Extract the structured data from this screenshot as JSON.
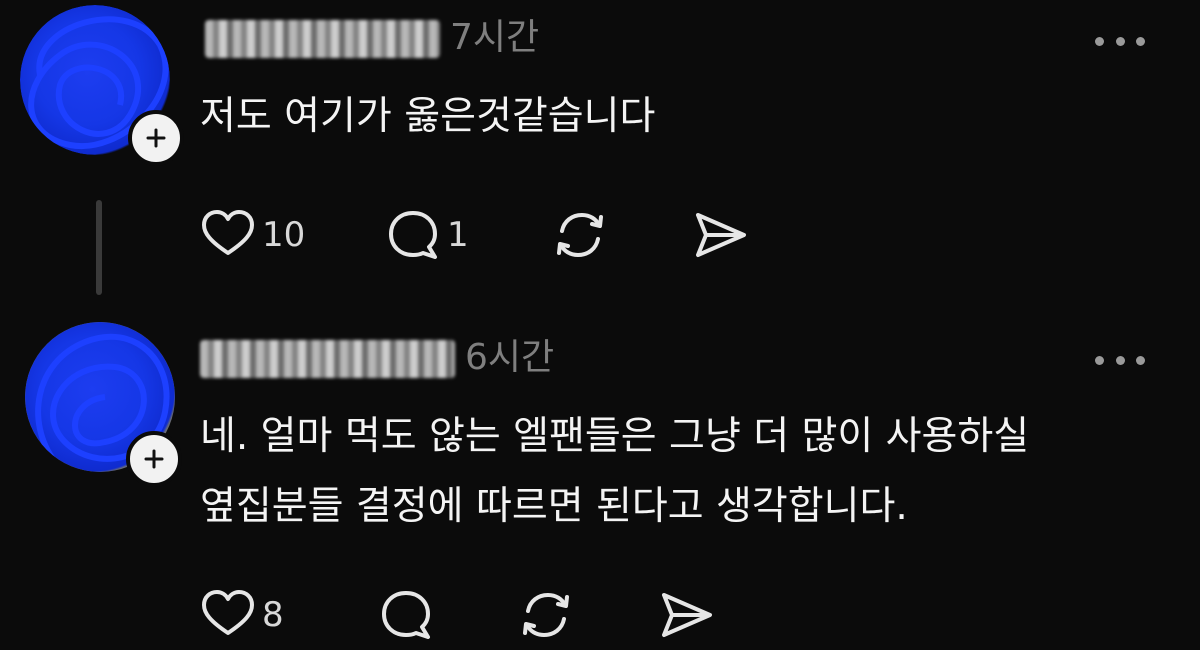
{
  "posts": [
    {
      "time": "7시간",
      "text_lines": [
        "저도 여기가 옳은것같습니다"
      ],
      "like_count": "10",
      "reply_count": "1"
    },
    {
      "time": "6시간",
      "text_lines": [
        "네. 얼마 먹도 않는 엘팬들은 그냥 더 많이 사용하실",
        "옆집분들 결정에 따르면 된다고 생각합니다."
      ],
      "like_count": "8",
      "reply_count": ""
    }
  ],
  "colors": {
    "background": "#0b0b0b",
    "scribble_blue": "#1537e6",
    "time_gray": "#7f7f7f"
  },
  "icons": [
    "heart-icon",
    "comment-icon",
    "repost-icon",
    "share-icon",
    "more-icon",
    "plus-icon"
  ]
}
